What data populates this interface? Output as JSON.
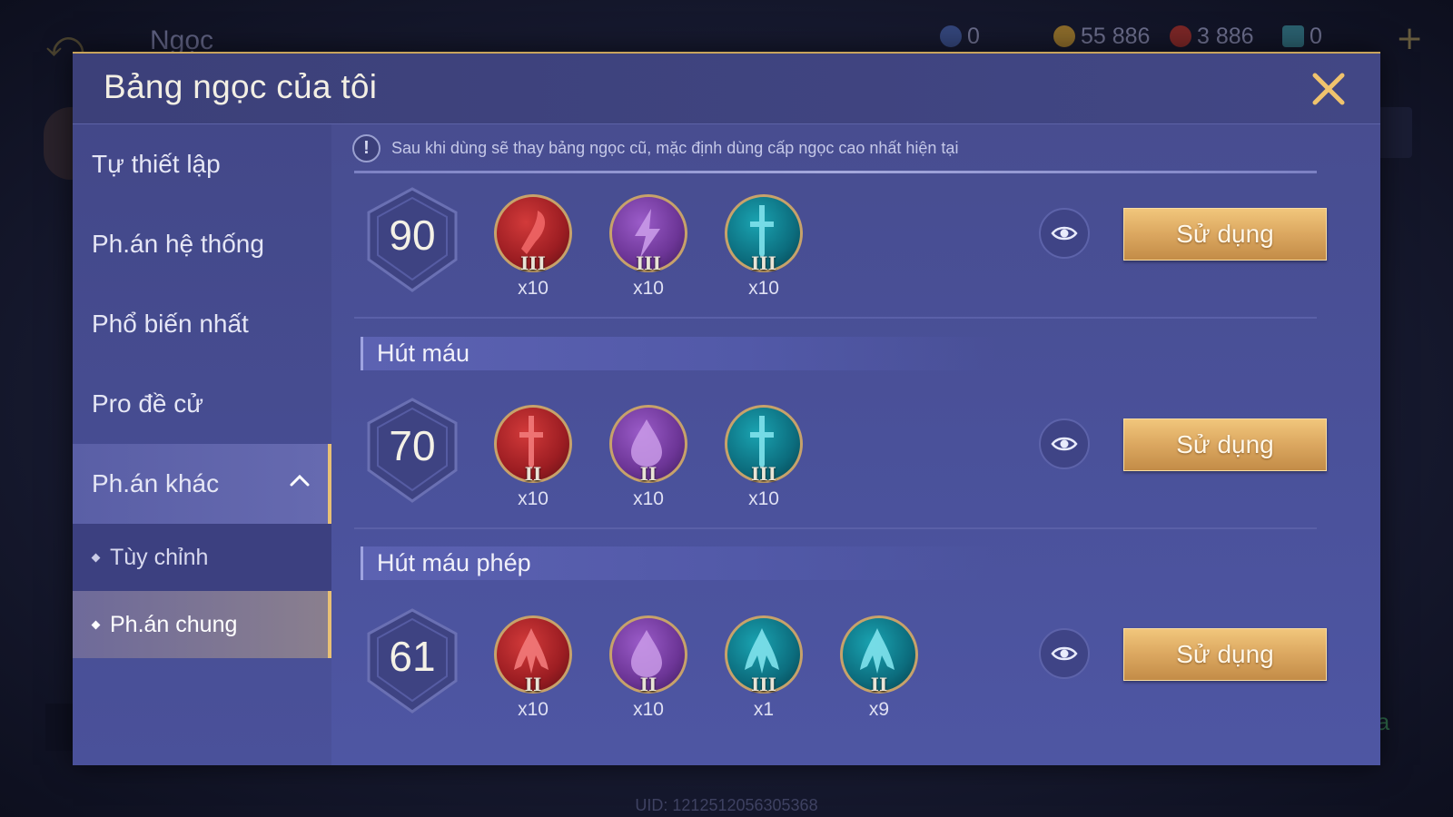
{
  "background": {
    "back_glyph": "⤺",
    "title": "Ngọc",
    "plus": "+",
    "uid": "UID: 1212512056305368",
    "right_green": "ia",
    "currencies": [
      {
        "icon": "blue-coin-icon",
        "value": "0",
        "color": "#3a4f8a"
      },
      {
        "icon": "gold-coin-icon",
        "value": "55 886",
        "color": "#8a6a2a"
      },
      {
        "icon": "red-gem-icon",
        "value": "3 886",
        "color": "#8a2a2a"
      },
      {
        "icon": "ticket-icon",
        "value": "0",
        "color": "#2a6a7a"
      }
    ]
  },
  "modal": {
    "title": "Bảng ngọc của tôi",
    "close_icon": "close-icon"
  },
  "sidebar": {
    "items": [
      {
        "label": "Tự thiết lập"
      },
      {
        "label": "Ph.án hệ thống"
      },
      {
        "label": "Phổ biến nhất"
      },
      {
        "label": "Pro đề cử"
      },
      {
        "label": "Ph.án khác",
        "active": true,
        "expanded": true
      }
    ],
    "subitems": [
      {
        "label": "Tùy chỉnh"
      },
      {
        "label": "Ph.án chung",
        "active": true
      }
    ]
  },
  "notice": {
    "icon": "!",
    "text": "Sau khi dùng sẽ thay bảng ngọc cũ, mặc định dùng cấp ngọc cao nhất hiện tại"
  },
  "setups": [
    {
      "header": "",
      "level": "90",
      "gems": [
        {
          "color": "red",
          "icon": "blade-icon",
          "tier": "III",
          "count": "x10"
        },
        {
          "color": "purple",
          "icon": "lightning-icon",
          "tier": "III",
          "count": "x10"
        },
        {
          "color": "teal",
          "icon": "sword-icon",
          "tier": "III",
          "count": "x10"
        }
      ],
      "button": "Sử dụng"
    },
    {
      "header": "Hút máu",
      "level": "70",
      "gems": [
        {
          "color": "red",
          "icon": "sword-icon",
          "tier": "II",
          "count": "x10"
        },
        {
          "color": "purple",
          "icon": "drop-icon",
          "tier": "II",
          "count": "x10"
        },
        {
          "color": "teal",
          "icon": "sword-icon",
          "tier": "III",
          "count": "x10"
        }
      ],
      "button": "Sử dụng"
    },
    {
      "header": "Hút máu phép",
      "level": "61",
      "gems": [
        {
          "color": "red",
          "icon": "fang-icon",
          "tier": "II",
          "count": "x10"
        },
        {
          "color": "purple",
          "icon": "drop-icon",
          "tier": "II",
          "count": "x10"
        },
        {
          "color": "teal",
          "icon": "fang-icon",
          "tier": "III",
          "count": "x1"
        },
        {
          "color": "teal",
          "icon": "fang-icon",
          "tier": "II",
          "count": "x9"
        }
      ],
      "button": "Sử dụng"
    }
  ],
  "colors": {
    "accent_gold": "#e8c075",
    "modal_bg": "#4a519a",
    "button_gold": "#dba760"
  }
}
